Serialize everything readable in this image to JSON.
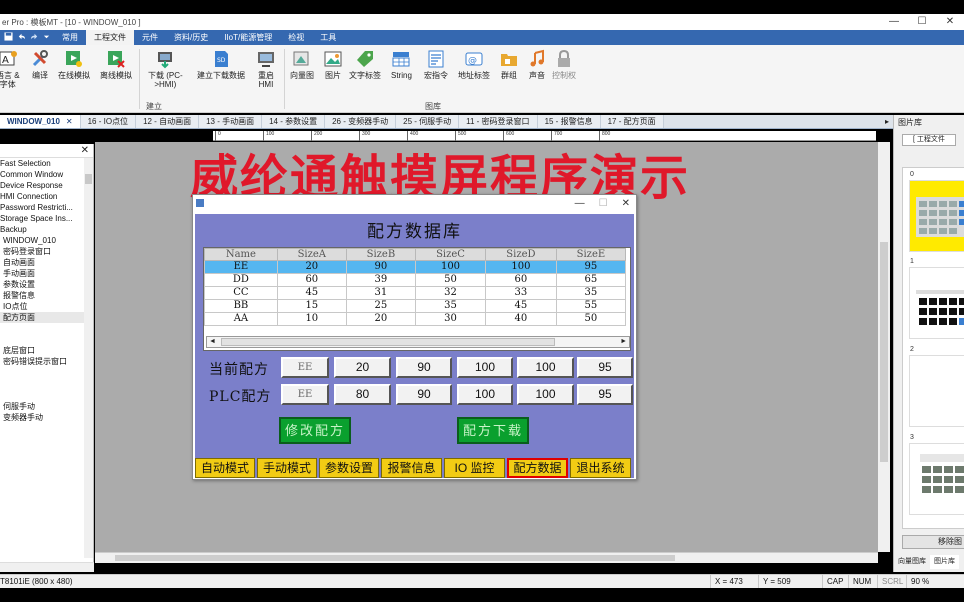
{
  "window": {
    "title": "er Pro : 模板MT - [10 - WINDOW_010 ]",
    "minimize": "—",
    "maximize": "☐",
    "close": "✕"
  },
  "menu": {
    "tabs": [
      "常用",
      "工程文件",
      "元件",
      "资料/历史",
      "IIoT/能源管理",
      "检视",
      "工具"
    ],
    "active_index": 1
  },
  "ribbon": {
    "buttons": [
      {
        "label": "语言 &\n字体",
        "icon": "font-language-icon"
      },
      {
        "label": "编译",
        "icon": "compile-tools-icon"
      },
      {
        "label": "在线模拟",
        "icon": "online-simulation-icon"
      },
      {
        "label": "离线模拟",
        "icon": "offline-simulation-icon"
      },
      {
        "label": "下载 (PC-\n>HMI)",
        "icon": "download-icon"
      },
      {
        "label": "建立下载数据",
        "icon": "sd-card-icon"
      },
      {
        "label": "重启\nHMI",
        "icon": "restart-hmi-icon"
      },
      {
        "label": "向量图",
        "icon": "vector-graphic-icon"
      },
      {
        "label": "图片",
        "icon": "picture-icon"
      },
      {
        "label": "文字标签",
        "icon": "text-tag-icon"
      },
      {
        "label": "String",
        "icon": "string-table-icon"
      },
      {
        "label": "宏指令",
        "icon": "macro-icon"
      },
      {
        "label": "地址标签",
        "icon": "address-tag-icon"
      },
      {
        "label": "群组",
        "icon": "group-icon"
      },
      {
        "label": "声音",
        "icon": "sound-icon"
      },
      {
        "label": "控制权",
        "icon": "lock-icon"
      }
    ],
    "group_build": "建立",
    "group_library": "图库"
  },
  "doc_tabs": [
    "WINDOW_010",
    "16 - IO点位",
    "12 - 自动画面",
    "13 - 手动画面",
    "14 - 参数设置",
    "26 - 变频器手动",
    "25 - 伺服手动",
    "11 - 密码登录窗口",
    "15 - 报警信息",
    "17 - 配方页面"
  ],
  "left_tree": {
    "close": "✕",
    "items": [
      "Fast Selection",
      "Common Window",
      "Device Response",
      "HMI Connection",
      "Password Restricti...",
      "Storage Space Ins...",
      "Backup",
      "WINDOW_010",
      "密码登录窗口",
      "自动画面",
      "手动画面",
      "参数设置",
      "报警信息",
      "IO点位",
      "配方页面"
    ],
    "items2": [
      "底层窗口",
      "密码错误提示窗口"
    ],
    "items3": [
      "伺服手动",
      "变频器手动"
    ]
  },
  "ruler": {
    "labels": [
      "0",
      "100",
      "200",
      "300",
      "400",
      "500",
      "600",
      "700",
      "800"
    ]
  },
  "overlay_title": "威纶通触摸屏程序演示",
  "hmi": {
    "title": "配方数据库",
    "table": {
      "columns": [
        "Name",
        "SizeA",
        "SizeB",
        "SizeC",
        "SizeD",
        "SizeE"
      ],
      "rows": [
        [
          "EE",
          "20",
          "90",
          "100",
          "100",
          "95"
        ],
        [
          "DD",
          "60",
          "39",
          "50",
          "60",
          "65"
        ],
        [
          "CC",
          "45",
          "31",
          "32",
          "33",
          "35"
        ],
        [
          "BB",
          "15",
          "25",
          "35",
          "45",
          "55"
        ],
        [
          "AA",
          "10",
          "20",
          "30",
          "40",
          "50"
        ]
      ],
      "selected_row": 0,
      "scroll_left": "◄",
      "scroll_right": "►"
    },
    "current_recipe": {
      "label": "当前配方",
      "name": "EE",
      "values": [
        "20",
        "90",
        "100",
        "100",
        "95"
      ]
    },
    "plc_recipe": {
      "label": "PLC配方",
      "name": "EE",
      "values": [
        "80",
        "90",
        "100",
        "100",
        "95"
      ]
    },
    "modify_button": "修改配方",
    "download_button": "配方下载",
    "nav": [
      "自动模式",
      "手动模式",
      "参数设置",
      "报警信息",
      "IO 监控",
      "配方数据",
      "退出系统"
    ],
    "nav_active": 5
  },
  "right_panel": {
    "title": "图片库",
    "dropdown": "[ 工程文件",
    "thumb_numbers": [
      "0",
      "1",
      "2",
      "3"
    ],
    "remove_button": "移除图",
    "tabs": [
      "向量图库",
      "图片库"
    ]
  },
  "status": {
    "device": "T8101iE (800 x 480)",
    "x": "X = 473",
    "y": "Y = 509",
    "cap": "CAP",
    "num": "NUM",
    "scrl": "SCRL",
    "zoom": "90 %"
  },
  "colors": {
    "menu_bar": "#3568b0",
    "hmi_background": "#7b7fca",
    "selected_row": "#55b6f0",
    "green_button": "#0aa02e",
    "nav_button": "#f2cc14",
    "overlay_title": "#e0182a"
  }
}
